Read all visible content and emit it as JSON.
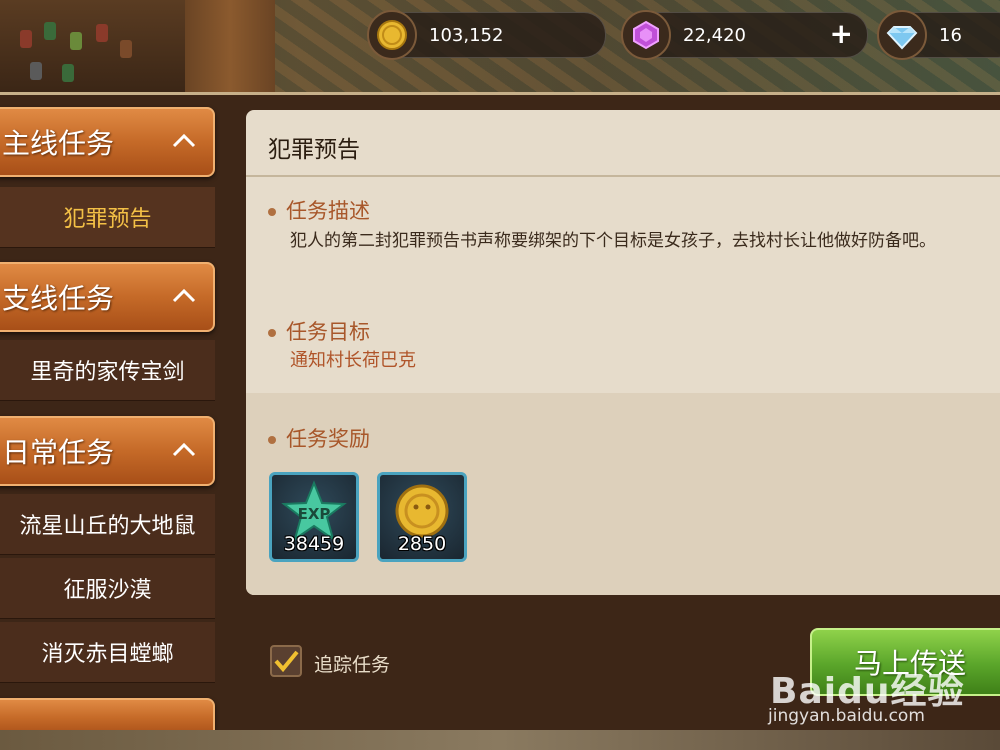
{
  "currency": {
    "gold": {
      "icon": "gold-coin-icon",
      "value": "103,152"
    },
    "gem": {
      "icon": "purple-gem-icon",
      "value": "22,420",
      "add_icon": "plus-icon"
    },
    "diamond": {
      "icon": "blue-diamond-icon",
      "value": "16"
    }
  },
  "sidebar": {
    "categories": [
      {
        "label": "主线任务",
        "items": [
          {
            "label": "犯罪预告",
            "active": true
          }
        ]
      },
      {
        "label": "支线任务",
        "items": [
          {
            "label": "里奇的家传宝剑"
          }
        ]
      },
      {
        "label": "日常任务",
        "items": [
          {
            "label": "流星山丘的大地鼠"
          },
          {
            "label": "征服沙漠"
          },
          {
            "label": "消灭赤目螳螂"
          }
        ]
      }
    ]
  },
  "quest": {
    "title": "犯罪预告",
    "description_heading": "任务描述",
    "description": "犯人的第二封犯罪预告书声称要绑架的下个目标是女孩子，去找村长让他做好防备吧。",
    "objective_heading": "任务目标",
    "objective": "通知村长荷巴克",
    "reward_heading": "任务奖励",
    "rewards": [
      {
        "icon": "exp-star-icon",
        "amount": "38459"
      },
      {
        "icon": "gold-coin-icon",
        "amount": "2850"
      }
    ]
  },
  "controls": {
    "track_label": "追踪任务",
    "track_checked": true,
    "teleport_label": "马上传送"
  },
  "watermark": {
    "text": "Baidu经验",
    "sub": "jingyan.baidu.com"
  }
}
